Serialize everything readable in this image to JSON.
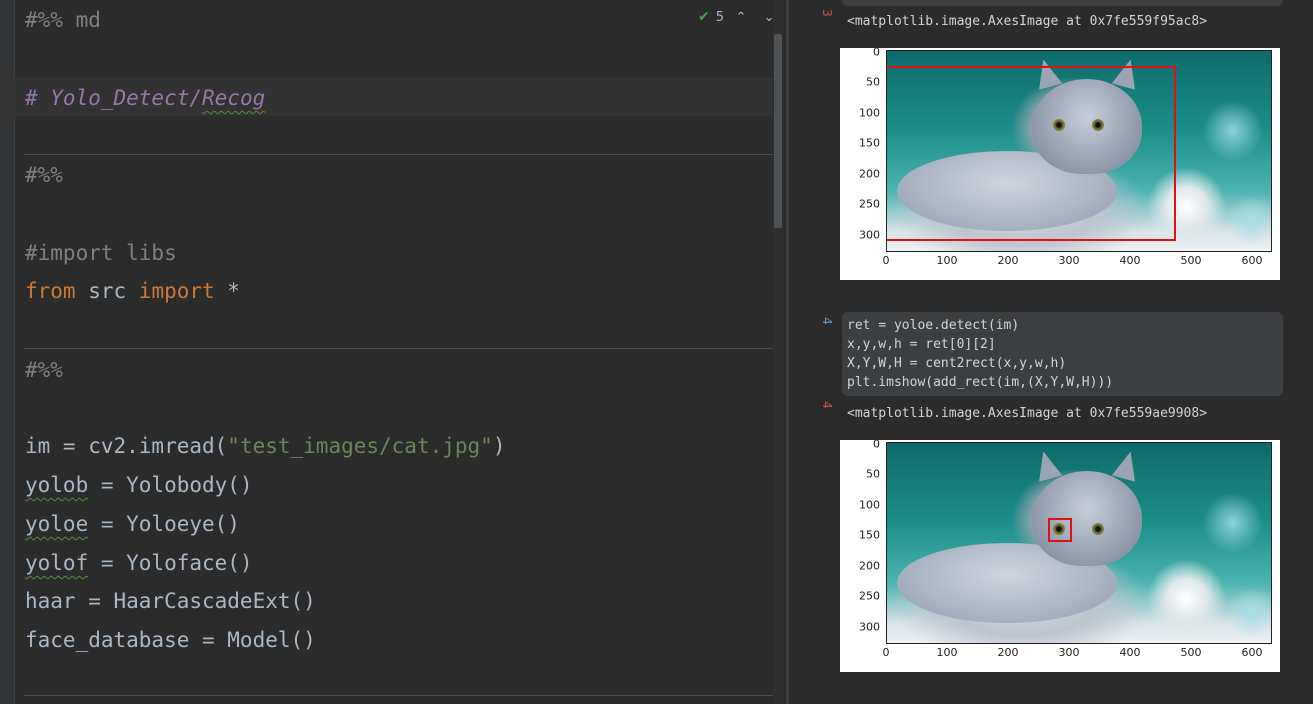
{
  "editor": {
    "inspection_count": "5",
    "lines": [
      {
        "text": "#%% md"
      },
      {
        "text": "# Yolo_Detect/",
        "extra": "Recog"
      },
      {
        "text": "#%%"
      },
      {
        "text": "#import libs"
      },
      {
        "kw1": "from",
        "mid": " src ",
        "kw2": "import",
        "tail": " *"
      },
      {
        "text": "#%%"
      },
      {
        "pre": "im = cv2.imread(",
        "str": "\"test_images/cat.jpg\"",
        "post": ")"
      },
      {
        "var": "yolob",
        "rest": " = Yolobody()"
      },
      {
        "var": "yoloe",
        "rest": " = Yoloeye()"
      },
      {
        "var": "yolof",
        "rest": " = Yoloface()"
      },
      {
        "text": "haar = HaarCascadeExt()"
      },
      {
        "text": "face_database = Model()"
      }
    ]
  },
  "output": {
    "cell3": {
      "label": "3",
      "repr": "<matplotlib.image.AxesImage at 0x7fe559f95ac8>"
    },
    "cell4": {
      "label": "4",
      "out_label": "4",
      "code": [
        "ret = yoloe.detect(im)",
        "x,y,w,h = ret[0][2]",
        "X,Y,W,H = cent2rect(x,y,w,h)",
        "plt.imshow(add_rect(im,(X,Y,W,H)))"
      ],
      "repr": "<matplotlib.image.AxesImage at 0x7fe559ae9908>"
    },
    "axes": {
      "yticks": [
        "0",
        "50",
        "100",
        "150",
        "200",
        "250",
        "300"
      ],
      "xticks": [
        "0",
        "100",
        "200",
        "300",
        "400",
        "500",
        "600"
      ]
    }
  }
}
